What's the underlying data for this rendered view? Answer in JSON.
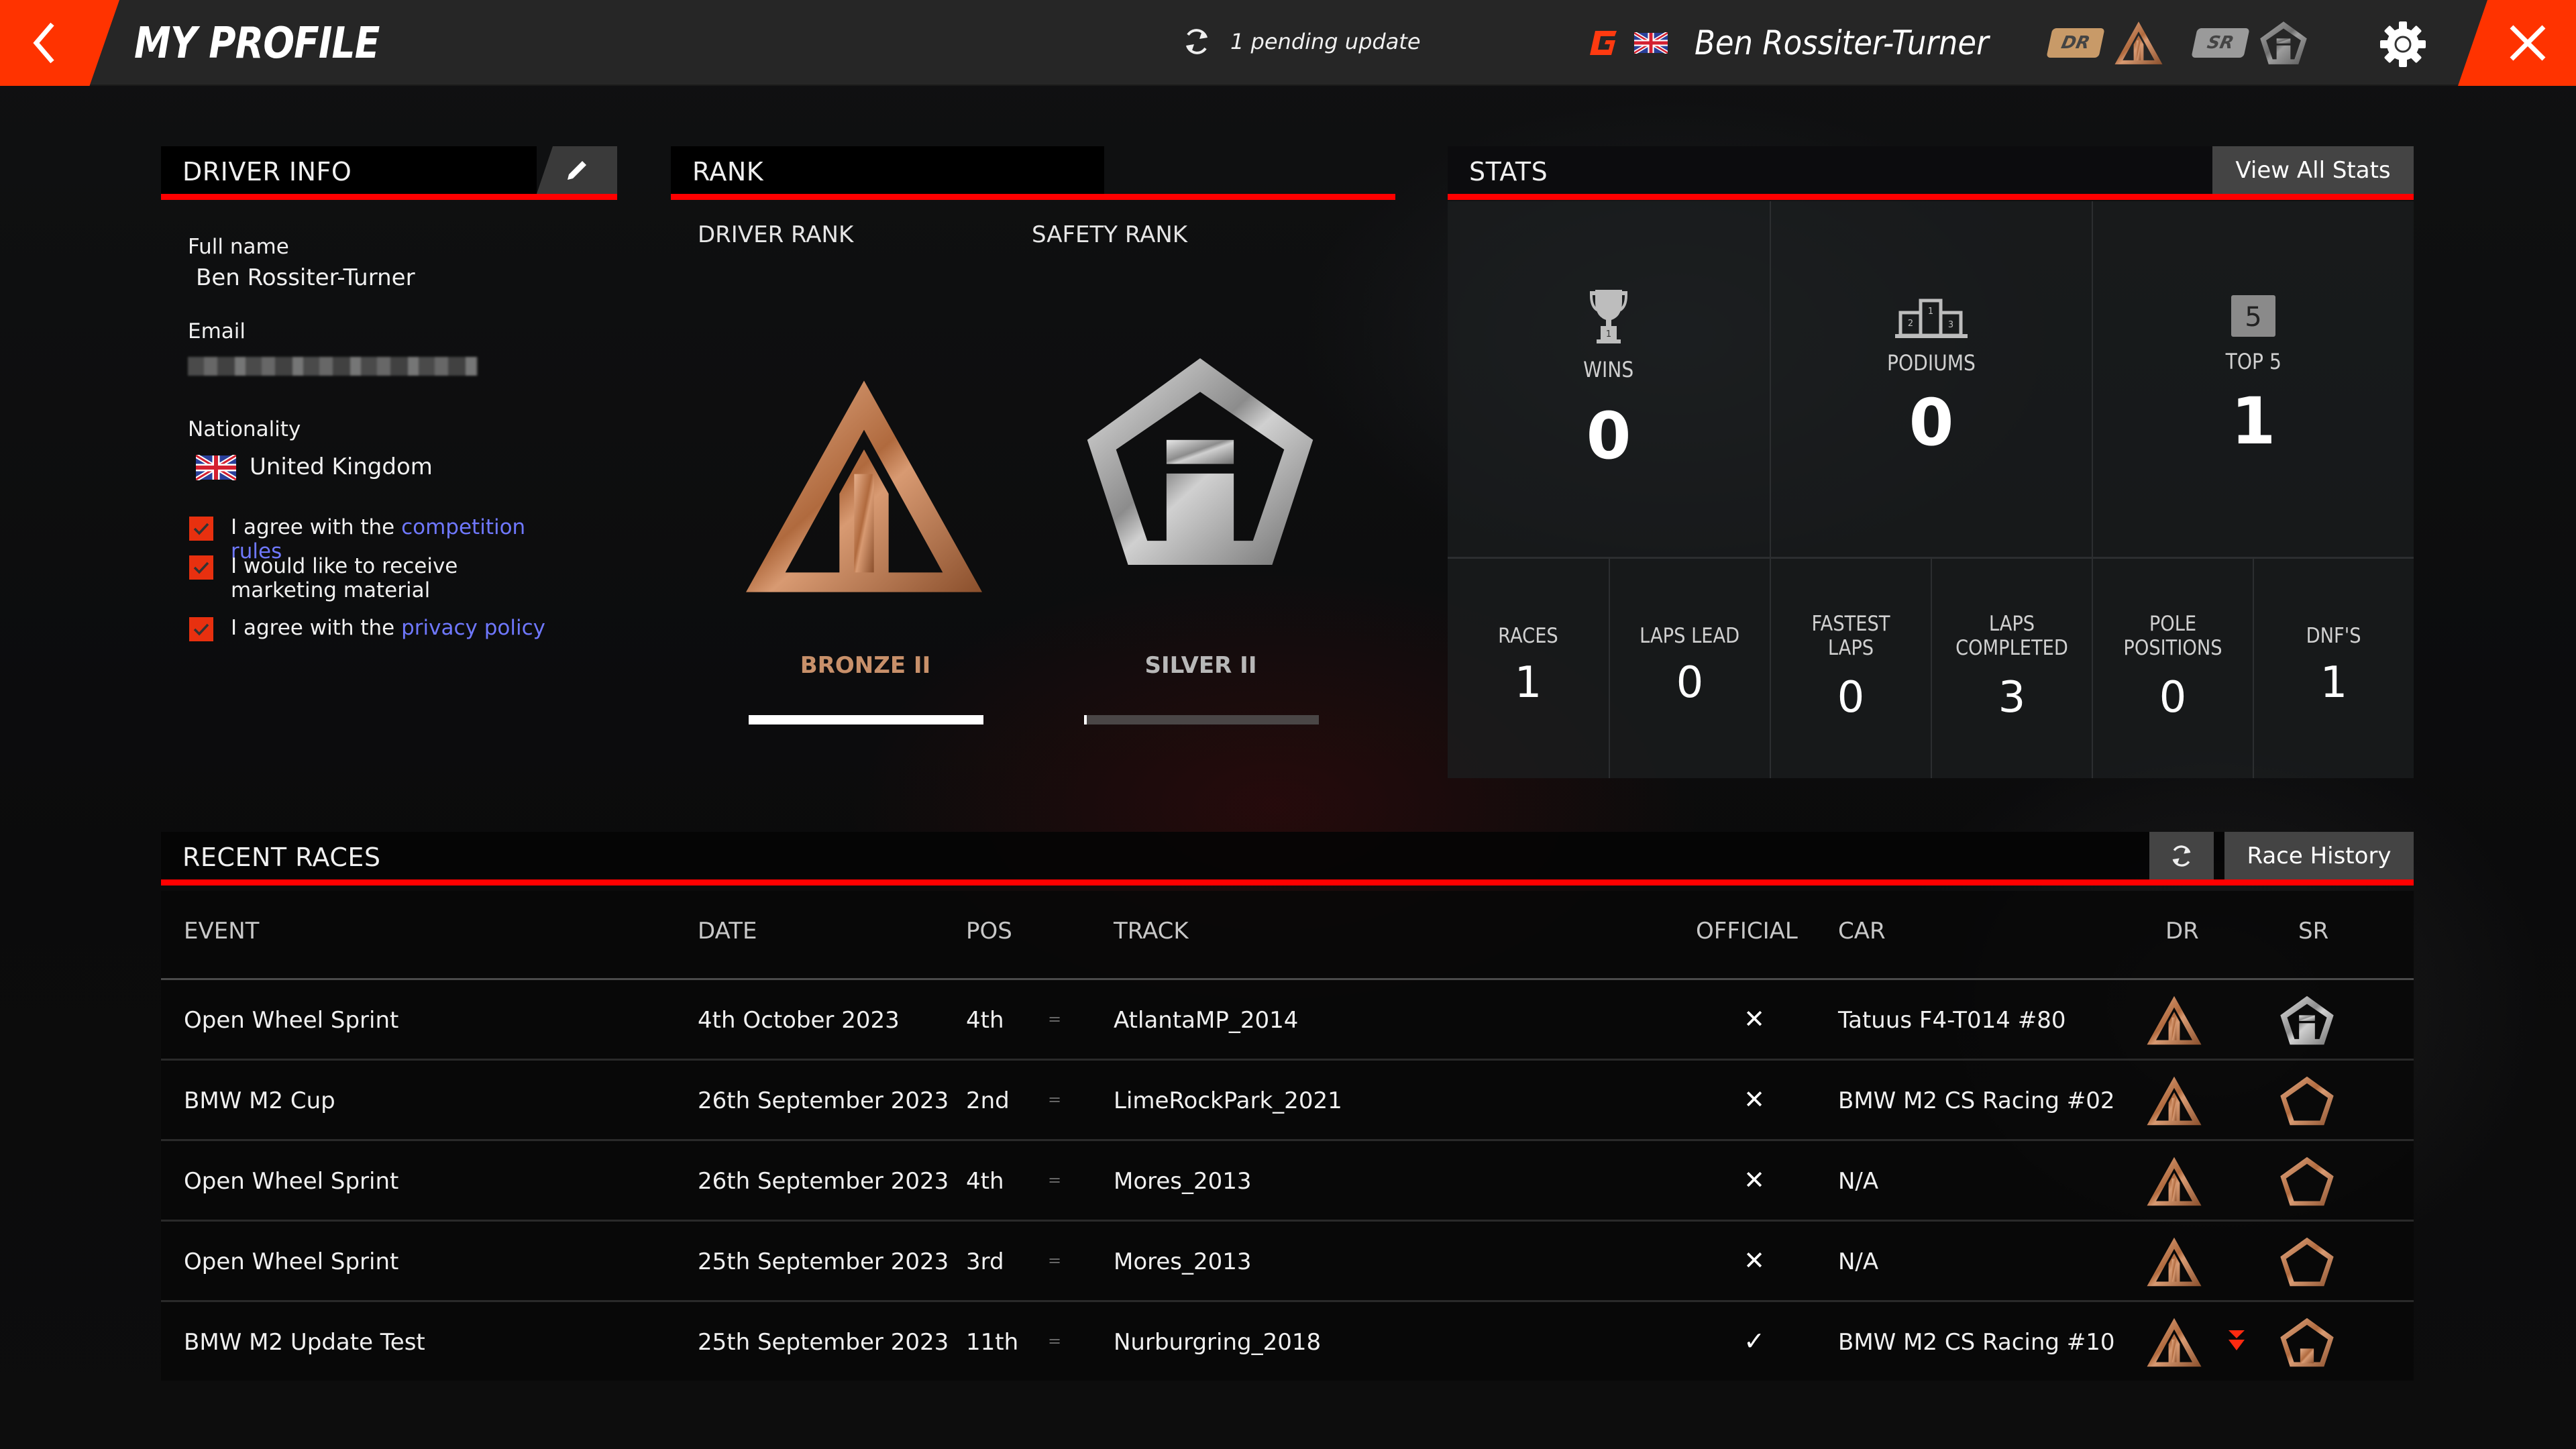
{
  "header": {
    "title": "MY PROFILE",
    "pending_update": "1 pending update",
    "username": "Ben Rossiter-Turner",
    "dr_tag": "DR",
    "sr_tag": "SR",
    "driver_rank_tier": "bronze",
    "safety_rank_tier": "silver"
  },
  "driver_info": {
    "title": "DRIVER INFO",
    "full_name_label": "Full name",
    "full_name": "Ben Rossiter-Turner",
    "email_label": "Email",
    "email_value": "[redacted]",
    "nationality_label": "Nationality",
    "nationality": "United Kingdom",
    "checkboxes": [
      {
        "text": "I agree with the ",
        "link": "competition rules",
        "checked": true
      },
      {
        "text": "I would like to receive marketing material",
        "link": "",
        "checked": true
      },
      {
        "text": "I agree with the ",
        "link": "privacy policy",
        "checked": true
      }
    ]
  },
  "rank": {
    "title": "RANK",
    "driver_rank_label": "DRIVER RANK",
    "safety_rank_label": "SAFETY RANK",
    "driver_rank_name": "BRONZE II",
    "safety_rank_name": "SILVER II",
    "driver_rank_progress": 1.0,
    "safety_rank_progress": 0.01,
    "colors": {
      "bronze": "#c8906a",
      "silver": "#b8b8b8"
    }
  },
  "stats": {
    "title": "STATS",
    "view_all_label": "View All Stats",
    "primary": [
      {
        "label": "WINS",
        "value": "0",
        "icon": "trophy-icon"
      },
      {
        "label": "PODIUMS",
        "value": "0",
        "icon": "podium-icon"
      },
      {
        "label": "TOP 5",
        "value": "1",
        "icon": "top5-icon",
        "badge": "5"
      }
    ],
    "secondary": [
      {
        "label": "RACES",
        "value": "1"
      },
      {
        "label": "LAPS LEAD",
        "value": "0"
      },
      {
        "label": "FASTEST LAPS",
        "value": "0"
      },
      {
        "label": "LAPS COMPLETED",
        "value": "3"
      },
      {
        "label": "POLE POSITIONS",
        "value": "0"
      },
      {
        "label": "DNF'S",
        "value": "1"
      }
    ]
  },
  "recent_races": {
    "title": "RECENT RACES",
    "race_history_label": "Race History",
    "columns": {
      "event": "EVENT",
      "date": "DATE",
      "pos": "POS",
      "track": "TRACK",
      "official": "OFFICIAL",
      "car": "CAR",
      "dr": "DR",
      "sr": "SR"
    },
    "rows": [
      {
        "event": "Open Wheel Sprint",
        "date": "4th October 2023",
        "pos": "4th",
        "change": "=",
        "track": "AtlantaMP_2014",
        "official": "✕",
        "car": "Tatuus F4-T014 #80",
        "dr": "bronze",
        "sr": "silver",
        "dr_change": ""
      },
      {
        "event": "BMW M2 Cup",
        "date": "26th September 2023",
        "pos": "2nd",
        "change": "=",
        "track": "LimeRockPark_2021",
        "official": "✕",
        "car": "BMW M2 CS Racing #02",
        "dr": "bronze",
        "sr": "bronze-empty",
        "dr_change": ""
      },
      {
        "event": "Open Wheel Sprint",
        "date": "26th September 2023",
        "pos": "4th",
        "change": "=",
        "track": "Mores_2013",
        "official": "✕",
        "car": "N/A",
        "dr": "bronze",
        "sr": "bronze-empty",
        "dr_change": ""
      },
      {
        "event": "Open Wheel Sprint",
        "date": "25th September 2023",
        "pos": "3rd",
        "change": "=",
        "track": "Mores_2013",
        "official": "✕",
        "car": "N/A",
        "dr": "bronze",
        "sr": "bronze-empty",
        "dr_change": ""
      },
      {
        "event": "BMW M2 Update Test",
        "date": "25th September 2023",
        "pos": "11th",
        "change": "=",
        "track": "Nurburgring_2018",
        "official": "✓",
        "car": "BMW M2 CS Racing #10",
        "dr": "bronze",
        "sr": "bronze-partial",
        "dr_change": "down"
      }
    ]
  },
  "colors": {
    "accent": "#ff3300",
    "header_rule": "#ff0000",
    "link": "#6f78ff",
    "checkbox": "#e8300f"
  }
}
